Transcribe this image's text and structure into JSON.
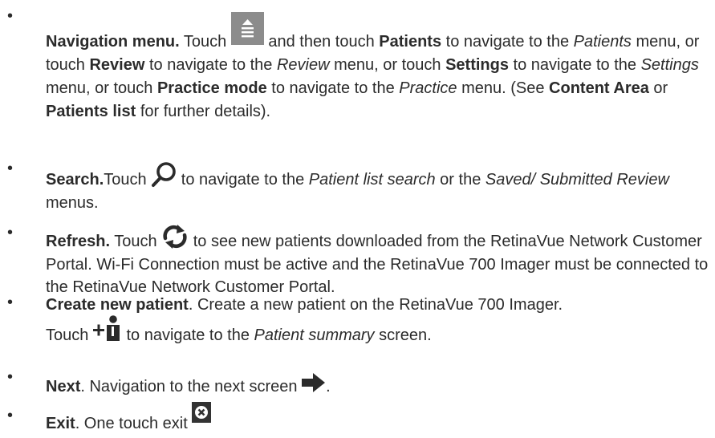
{
  "items": [
    {
      "title": "Navigation menu.",
      "t1": " Touch ",
      "t2": " and then touch ",
      "b1": "Patients",
      "t3": " to navigate to the ",
      "i1": "Patients",
      "t4": " menu, or touch ",
      "b2": "Review",
      "t5": " to navigate to the ",
      "i2": "Review",
      "t6": " menu, or touch ",
      "b3": "Settings",
      "t7": " to navigate to the ",
      "i3": "Settings",
      "t8": " menu, or touch ",
      "b4": "Practice mode",
      "t9": " to navigate to the ",
      "i4": "Practice",
      "t10": " menu. (See ",
      "b5": "Content Area",
      "t11": " or ",
      "b6": "Patients list",
      "t12": " for further details).",
      "icon": "navigation-menu-icon"
    },
    {
      "title": "Search.",
      "t1": "Touch ",
      "t2": " to navigate to the ",
      "i1": "Patient list search",
      "t3": " or the ",
      "i2": "Saved/ Submitted Review",
      "t4": " menus.",
      "icon": "search-icon"
    },
    {
      "title": "Refresh.",
      "t1": " Touch ",
      "t2": " to see new patients downloaded from the RetinaVue Network Customer Portal. Wi-Fi Connection must be active and the RetinaVue 700 Imager must be connected to the RetinaVue Network Customer Portal.",
      "icon": "refresh-icon"
    },
    {
      "title": "Create new patient",
      "t1": ". Create a new patient on the RetinaVue 700 Imager.",
      "t2": "Touch ",
      "t3": " to navigate to the ",
      "i1": "Patient summary",
      "t4": " screen.",
      "icon": "add-patient-icon"
    },
    {
      "title": "Next",
      "t1": ". Navigation to the next screen ",
      "t2": ".",
      "icon": "next-arrow-icon"
    },
    {
      "title": "Exit",
      "t1": ". One touch exit ",
      "icon": "exit-icon"
    }
  ],
  "colors": {
    "text": "#2b2b2b",
    "menu_button": "#8c8c8c",
    "icon": "#2b2b2b"
  }
}
